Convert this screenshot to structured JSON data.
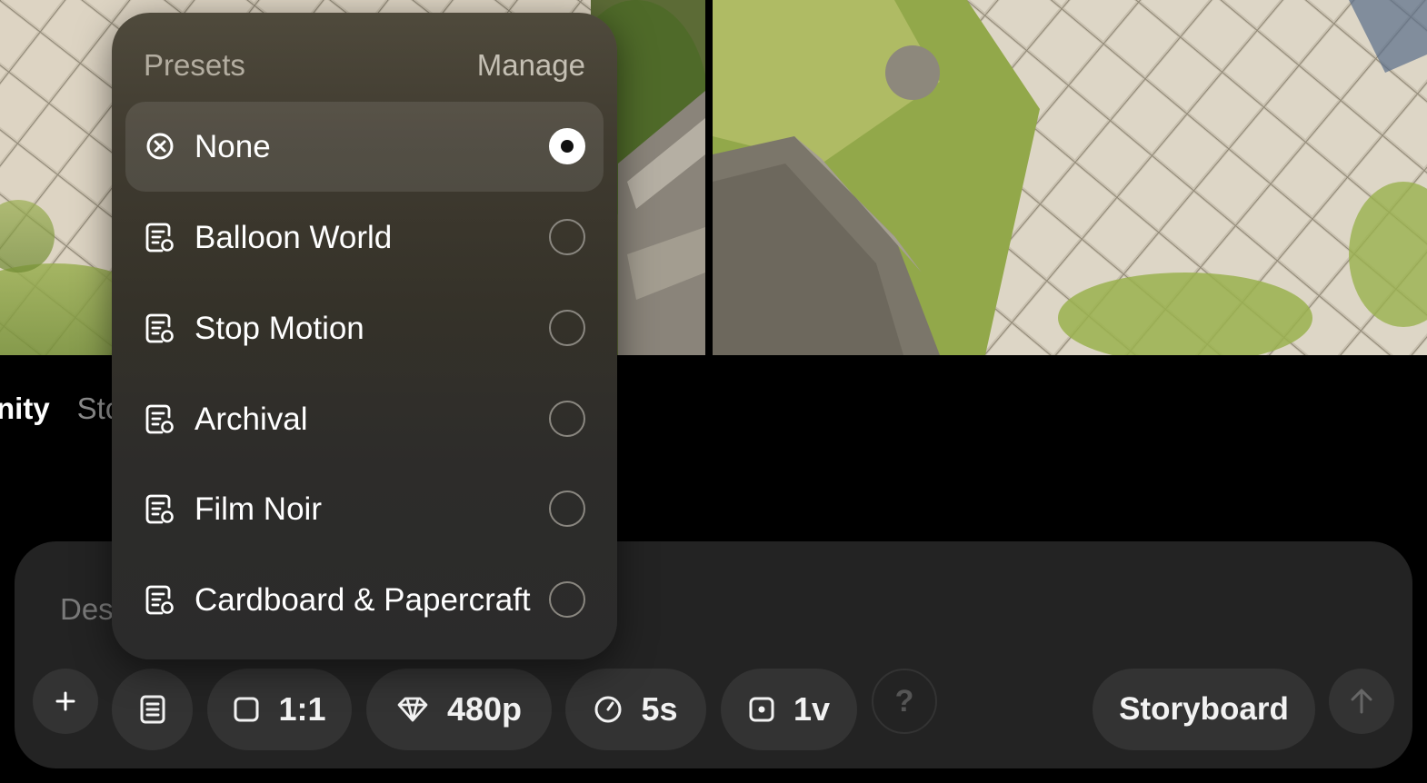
{
  "tabs": [
    {
      "label": "nity",
      "active": true
    },
    {
      "label": "Sto",
      "active": false
    }
  ],
  "prompt": {
    "placeholder": "Des"
  },
  "presets": {
    "title": "Presets",
    "manage_label": "Manage",
    "items": [
      {
        "label": "None",
        "icon": "circle-x-icon",
        "selected": true
      },
      {
        "label": "Balloon World",
        "icon": "preset-document-icon",
        "selected": false
      },
      {
        "label": "Stop Motion",
        "icon": "preset-document-icon",
        "selected": false
      },
      {
        "label": "Archival",
        "icon": "preset-document-icon",
        "selected": false
      },
      {
        "label": "Film Noir",
        "icon": "preset-document-icon",
        "selected": false
      },
      {
        "label": "Cardboard & Papercraft",
        "icon": "preset-document-icon",
        "selected": false
      }
    ]
  },
  "toolbar": {
    "add_icon": "plus-icon",
    "preset_icon": "document-list-icon",
    "aspect_ratio": "1:1",
    "resolution": "480p",
    "duration": "5s",
    "variations": "1v",
    "help_label": "?",
    "storyboard_label": "Storyboard",
    "submit_icon": "arrow-up-icon"
  },
  "colors": {
    "panel_bg": "#232323",
    "pill_bg": "#333333",
    "dropdown_top": "#4f4a3c",
    "dropdown_bottom": "#2b2b2b",
    "grass": "#8fa64a",
    "stone": "#cfc6b5"
  }
}
